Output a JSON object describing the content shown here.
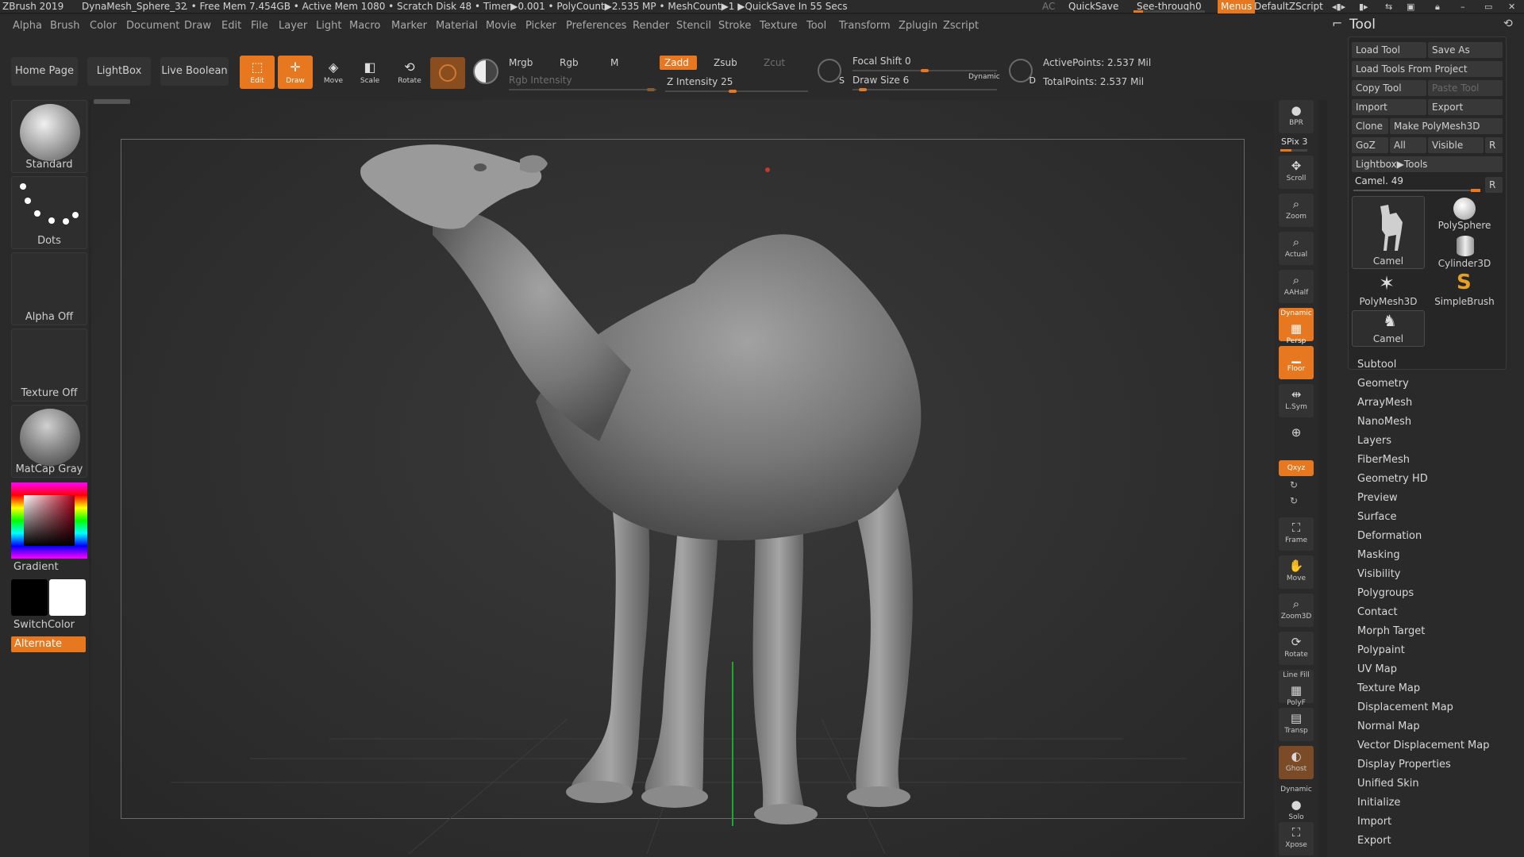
{
  "titlebar": {
    "app": "ZBrush 2019",
    "doc": "DynaMesh_Sphere_32",
    "status": ". • Free Mem 7.454GB • Active Mem 1080 • Scratch Disk 48 • Timer▶0.001 • PolyCount▶2.535 MP • MeshCount▶1 ▶QuickSave In 55 Secs",
    "ac": "AC",
    "quicksave": "QuickSave",
    "seethrough": "See-through",
    "seethrough_value": "0",
    "seethrough_fraction": 0,
    "menus": "Menus",
    "script": "DefaultZScript"
  },
  "menubar": [
    "Alpha",
    "Brush",
    "Color",
    "Document",
    "Draw",
    "Edit",
    "File",
    "Layer",
    "Light",
    "Macro",
    "Marker",
    "Material",
    "Movie",
    "Picker",
    "Preferences",
    "Render",
    "Stencil",
    "Stroke",
    "Texture",
    "Tool",
    "Transform",
    "Zplugin",
    "Zscript"
  ],
  "shelf": {
    "home": "Home Page",
    "lightbox": "LightBox",
    "liveboolean": "Live Boolean",
    "edit": "Edit",
    "draw": "Draw",
    "move": "Move",
    "scale": "Scale",
    "rotate": "Rotate",
    "mrgb": "Mrgb",
    "rgb": "Rgb",
    "m": "M",
    "rgb_intensity": "Rgb Intensity",
    "zadd": "Zadd",
    "zsub": "Zsub",
    "zcut": "Zcut",
    "z_intensity": "Z Intensity 25",
    "focal_shift": "Focal Shift 0",
    "draw_size": "Draw Size 6",
    "dynamic": "Dynamic",
    "active_points": "ActivePoints: 2.537 Mil",
    "total_points": "TotalPoints: 2.537 Mil",
    "s_label": "S",
    "d_label": "D"
  },
  "leftpanel": {
    "brush": "Standard",
    "stroke": "Dots",
    "alpha": "Alpha Off",
    "texture": "Texture Off",
    "material": "MatCap Gray",
    "gradient": "Gradient",
    "switchcolor": "SwitchColor",
    "alternate": "Alternate"
  },
  "righttools": {
    "bpr": "BPR",
    "spix": "SPix 3",
    "scroll": "Scroll",
    "zoom": "Zoom",
    "actual": "Actual",
    "aahalf": "AAHalf",
    "dynamic": "Dynamic",
    "persp": "Persp",
    "floor": "Floor",
    "lsym": "L.Sym",
    "xyz": "Qxyz",
    "frame": "Frame",
    "move": "Move",
    "zoom3d": "Zoom3D",
    "rotate": "Rotate",
    "linefill": "Line Fill",
    "polyf": "PolyF",
    "transp": "Transp",
    "ghost": "Ghost",
    "solo": "Solo",
    "xpose": "Xpose"
  },
  "tool": {
    "title": "Tool",
    "load_tool": "Load Tool",
    "save_as": "Save As",
    "load_from_project": "Load Tools From Project",
    "copy_tool": "Copy Tool",
    "paste_tool": "Paste Tool",
    "import": "Import",
    "export": "Export",
    "clone": "Clone",
    "make_polymesh": "Make PolyMesh3D",
    "goz": "GoZ",
    "all": "All",
    "visible": "Visible",
    "r": "R",
    "lightbox_tools": "Lightbox▶Tools",
    "current": "Camel. 49",
    "thumbs": [
      "Camel",
      "PolySphere",
      "Cylinder3D",
      "PolyMesh3D",
      "SimpleBrush",
      "Camel"
    ],
    "subpalettes": [
      "Subtool",
      "Geometry",
      "ArrayMesh",
      "NanoMesh",
      "Layers",
      "FiberMesh",
      "Geometry HD",
      "Preview",
      "Surface",
      "Deformation",
      "Masking",
      "Visibility",
      "Polygroups",
      "Contact",
      "Morph Target",
      "Polypaint",
      "UV Map",
      "Texture Map",
      "Displacement Map",
      "Normal Map",
      "Vector Displacement Map",
      "Display Properties",
      "Unified Skin",
      "Initialize",
      "Import",
      "Export"
    ]
  },
  "colors": {
    "accent": "#e8781f",
    "background": "#262626",
    "panel": "#2a2a2a"
  }
}
